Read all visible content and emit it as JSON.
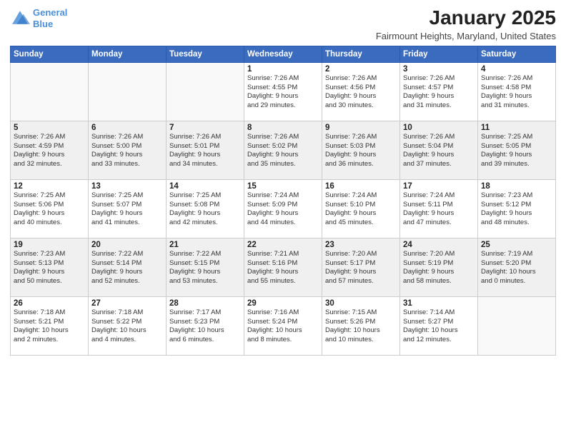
{
  "logo": {
    "line1": "General",
    "line2": "Blue"
  },
  "header": {
    "month": "January 2025",
    "location": "Fairmount Heights, Maryland, United States"
  },
  "weekdays": [
    "Sunday",
    "Monday",
    "Tuesday",
    "Wednesday",
    "Thursday",
    "Friday",
    "Saturday"
  ],
  "weeks": [
    [
      {
        "day": "",
        "info": ""
      },
      {
        "day": "",
        "info": ""
      },
      {
        "day": "",
        "info": ""
      },
      {
        "day": "1",
        "info": "Sunrise: 7:26 AM\nSunset: 4:55 PM\nDaylight: 9 hours\nand 29 minutes."
      },
      {
        "day": "2",
        "info": "Sunrise: 7:26 AM\nSunset: 4:56 PM\nDaylight: 9 hours\nand 30 minutes."
      },
      {
        "day": "3",
        "info": "Sunrise: 7:26 AM\nSunset: 4:57 PM\nDaylight: 9 hours\nand 31 minutes."
      },
      {
        "day": "4",
        "info": "Sunrise: 7:26 AM\nSunset: 4:58 PM\nDaylight: 9 hours\nand 31 minutes."
      }
    ],
    [
      {
        "day": "5",
        "info": "Sunrise: 7:26 AM\nSunset: 4:59 PM\nDaylight: 9 hours\nand 32 minutes."
      },
      {
        "day": "6",
        "info": "Sunrise: 7:26 AM\nSunset: 5:00 PM\nDaylight: 9 hours\nand 33 minutes."
      },
      {
        "day": "7",
        "info": "Sunrise: 7:26 AM\nSunset: 5:01 PM\nDaylight: 9 hours\nand 34 minutes."
      },
      {
        "day": "8",
        "info": "Sunrise: 7:26 AM\nSunset: 5:02 PM\nDaylight: 9 hours\nand 35 minutes."
      },
      {
        "day": "9",
        "info": "Sunrise: 7:26 AM\nSunset: 5:03 PM\nDaylight: 9 hours\nand 36 minutes."
      },
      {
        "day": "10",
        "info": "Sunrise: 7:26 AM\nSunset: 5:04 PM\nDaylight: 9 hours\nand 37 minutes."
      },
      {
        "day": "11",
        "info": "Sunrise: 7:25 AM\nSunset: 5:05 PM\nDaylight: 9 hours\nand 39 minutes."
      }
    ],
    [
      {
        "day": "12",
        "info": "Sunrise: 7:25 AM\nSunset: 5:06 PM\nDaylight: 9 hours\nand 40 minutes."
      },
      {
        "day": "13",
        "info": "Sunrise: 7:25 AM\nSunset: 5:07 PM\nDaylight: 9 hours\nand 41 minutes."
      },
      {
        "day": "14",
        "info": "Sunrise: 7:25 AM\nSunset: 5:08 PM\nDaylight: 9 hours\nand 42 minutes."
      },
      {
        "day": "15",
        "info": "Sunrise: 7:24 AM\nSunset: 5:09 PM\nDaylight: 9 hours\nand 44 minutes."
      },
      {
        "day": "16",
        "info": "Sunrise: 7:24 AM\nSunset: 5:10 PM\nDaylight: 9 hours\nand 45 minutes."
      },
      {
        "day": "17",
        "info": "Sunrise: 7:24 AM\nSunset: 5:11 PM\nDaylight: 9 hours\nand 47 minutes."
      },
      {
        "day": "18",
        "info": "Sunrise: 7:23 AM\nSunset: 5:12 PM\nDaylight: 9 hours\nand 48 minutes."
      }
    ],
    [
      {
        "day": "19",
        "info": "Sunrise: 7:23 AM\nSunset: 5:13 PM\nDaylight: 9 hours\nand 50 minutes."
      },
      {
        "day": "20",
        "info": "Sunrise: 7:22 AM\nSunset: 5:14 PM\nDaylight: 9 hours\nand 52 minutes."
      },
      {
        "day": "21",
        "info": "Sunrise: 7:22 AM\nSunset: 5:15 PM\nDaylight: 9 hours\nand 53 minutes."
      },
      {
        "day": "22",
        "info": "Sunrise: 7:21 AM\nSunset: 5:16 PM\nDaylight: 9 hours\nand 55 minutes."
      },
      {
        "day": "23",
        "info": "Sunrise: 7:20 AM\nSunset: 5:17 PM\nDaylight: 9 hours\nand 57 minutes."
      },
      {
        "day": "24",
        "info": "Sunrise: 7:20 AM\nSunset: 5:19 PM\nDaylight: 9 hours\nand 58 minutes."
      },
      {
        "day": "25",
        "info": "Sunrise: 7:19 AM\nSunset: 5:20 PM\nDaylight: 10 hours\nand 0 minutes."
      }
    ],
    [
      {
        "day": "26",
        "info": "Sunrise: 7:18 AM\nSunset: 5:21 PM\nDaylight: 10 hours\nand 2 minutes."
      },
      {
        "day": "27",
        "info": "Sunrise: 7:18 AM\nSunset: 5:22 PM\nDaylight: 10 hours\nand 4 minutes."
      },
      {
        "day": "28",
        "info": "Sunrise: 7:17 AM\nSunset: 5:23 PM\nDaylight: 10 hours\nand 6 minutes."
      },
      {
        "day": "29",
        "info": "Sunrise: 7:16 AM\nSunset: 5:24 PM\nDaylight: 10 hours\nand 8 minutes."
      },
      {
        "day": "30",
        "info": "Sunrise: 7:15 AM\nSunset: 5:26 PM\nDaylight: 10 hours\nand 10 minutes."
      },
      {
        "day": "31",
        "info": "Sunrise: 7:14 AM\nSunset: 5:27 PM\nDaylight: 10 hours\nand 12 minutes."
      },
      {
        "day": "",
        "info": ""
      }
    ]
  ]
}
